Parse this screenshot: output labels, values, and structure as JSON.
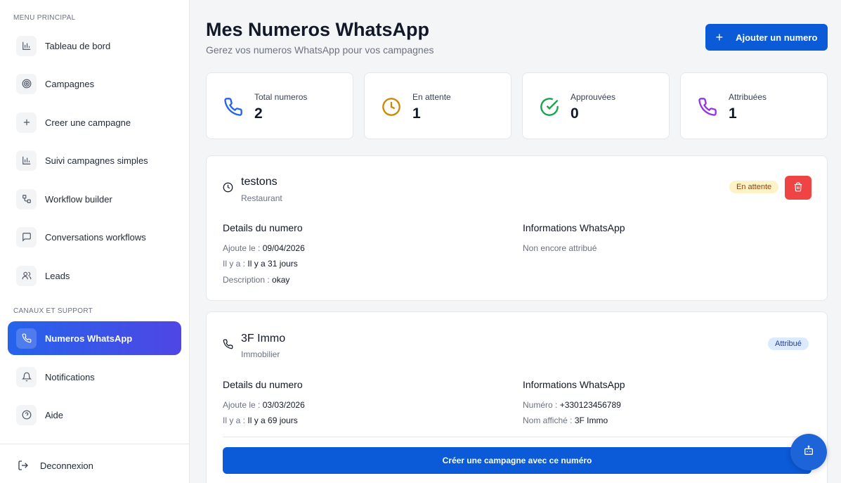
{
  "sidebar": {
    "section_main": "MENU PRINCIPAL",
    "section_channels": "CANAUX ET SUPPORT",
    "items": [
      {
        "label": "Tableau de bord",
        "icon": "bar-chart-icon"
      },
      {
        "label": "Campagnes",
        "icon": "target-icon"
      },
      {
        "label": "Creer une campagne",
        "icon": "plus-icon"
      },
      {
        "label": "Suivi campagnes simples",
        "icon": "bar-chart-icon"
      },
      {
        "label": "Workflow builder",
        "icon": "workflow-icon"
      },
      {
        "label": "Conversations workflows",
        "icon": "message-icon"
      },
      {
        "label": "Leads",
        "icon": "users-icon"
      }
    ],
    "support_items": [
      {
        "label": "Numeros WhatsApp",
        "icon": "phone-icon",
        "active": true
      },
      {
        "label": "Notifications",
        "icon": "bell-icon"
      },
      {
        "label": "Aide",
        "icon": "help-circle-icon"
      }
    ],
    "logout_label": "Deconnexion"
  },
  "header": {
    "title": "Mes Numeros WhatsApp",
    "subtitle": "Gerez vos numeros WhatsApp pour vos campagnes",
    "add_button": "Ajouter un numero"
  },
  "stats": [
    {
      "label": "Total numeros",
      "value": "2",
      "icon": "phone-icon",
      "color": "#2563eb"
    },
    {
      "label": "En attente",
      "value": "1",
      "icon": "clock-icon",
      "color": "#ca8a04"
    },
    {
      "label": "Approuvées",
      "value": "0",
      "icon": "check-circle-icon",
      "color": "#16a34a"
    },
    {
      "label": "Attribuées",
      "value": "1",
      "icon": "phone-icon",
      "color": "#9333ea"
    }
  ],
  "numbers": [
    {
      "name": "testons",
      "category": "Restaurant",
      "status": "En attente",
      "details_title": "Details du numero",
      "added_label": "Ajoute le :",
      "added_value": "09/04/2026",
      "ago_label": "Il y a :",
      "ago_value": "Il y a 31 jours",
      "desc_label": "Description :",
      "desc_value": "okay",
      "whatsapp_title": "Informations WhatsApp",
      "whatsapp_info": "Non encore attribué"
    },
    {
      "name": "3F Immo",
      "category": "Immobilier",
      "status": "Attribué",
      "details_title": "Details du numero",
      "added_label": "Ajoute le :",
      "added_value": "03/03/2026",
      "ago_label": "Il y a :",
      "ago_value": "Il y a 69 jours",
      "whatsapp_title": "Informations WhatsApp",
      "number_label": "Numéro :",
      "number_value": "+330123456789",
      "display_label": "Nom affiché :",
      "display_value": "3F Immo",
      "create_button": "Créer une campagne avec ce numéro"
    }
  ],
  "colors": {
    "primary": "#0b5ad8",
    "danger": "#ef4444",
    "active_gradient_start": "#2563eb",
    "active_gradient_end": "#4f46e5"
  }
}
